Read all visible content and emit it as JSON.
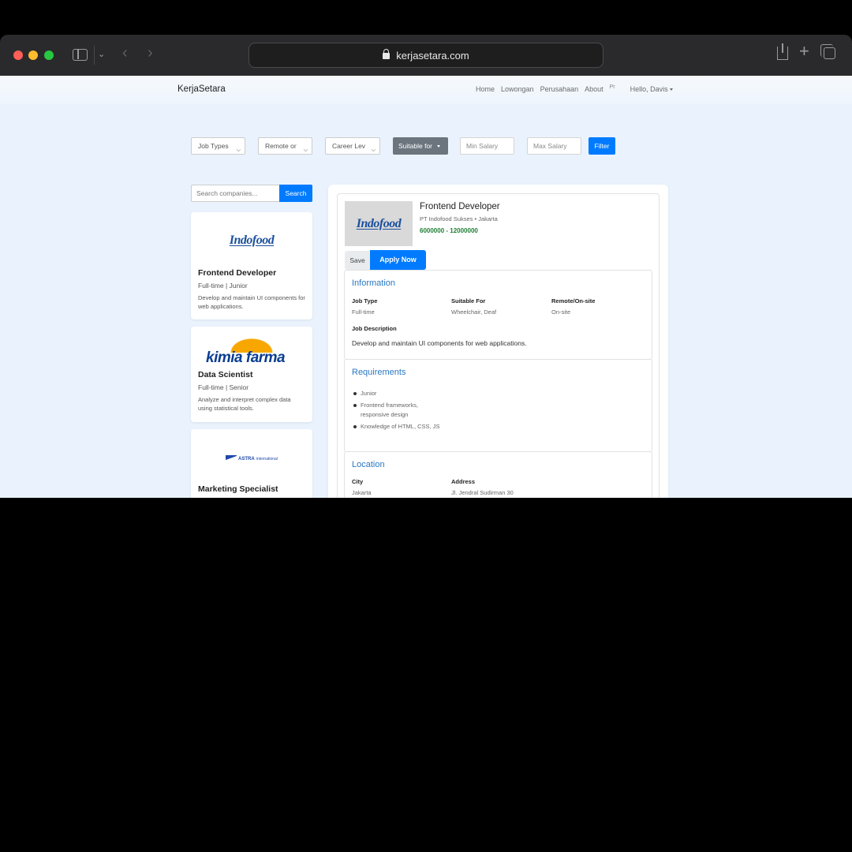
{
  "browser": {
    "url": "kerjasetara.com"
  },
  "navbar": {
    "brand": "KerjaSetara",
    "links": [
      "Home",
      "Lowongan",
      "Perusahaan",
      "About"
    ],
    "avatar_alt": "Pr",
    "user_greeting": "Hello, Davis"
  },
  "filters": {
    "job_types": "Job Types",
    "remote": "Remote or",
    "career_level": "Career Lev",
    "suitable_for": "Suitable for",
    "min_salary_placeholder": "Min Salary",
    "max_salary_placeholder": "Max Salary",
    "filter_label": "Filter"
  },
  "search": {
    "placeholder": "Search companies...",
    "button_label": "Search"
  },
  "jobs": [
    {
      "logo_text": "Indofood",
      "title": "Frontend Developer",
      "meta": "Full-time | Junior",
      "description": "Develop and maintain UI components for web applications."
    },
    {
      "logo_text": "kimia farma",
      "title": "Data Scientist",
      "meta": "Full-time | Senior",
      "description": "Analyze and interpret complex data using statistical tools."
    },
    {
      "logo_text_1": "ASTRA",
      "logo_text_2": "international",
      "title": "Marketing Specialist"
    }
  ],
  "detail": {
    "logo_text": "Indofood",
    "title": "Frontend Developer",
    "company": "PT Indofood Sukses • Jakarta",
    "salary": "6000000 - 12000000",
    "save_label": "Save",
    "apply_label": "Apply Now",
    "information": {
      "heading": "Information",
      "job_type_label": "Job Type",
      "job_type": "Full-time",
      "suitable_label": "Suitable For",
      "suitable": "Wheelchair, Deaf",
      "remote_label": "Remote/On-site",
      "remote": "On-site",
      "desc_label": "Job Description",
      "description": "Develop and maintain UI components for web applications."
    },
    "requirements": {
      "heading": "Requirements",
      "items": [
        "Junior",
        "Frontend frameworks, responsive design",
        "Knowledge of HTML, CSS, JS"
      ]
    },
    "location": {
      "heading": "Location",
      "city_label": "City",
      "city": "Jakarta",
      "address_label": "Address",
      "address": "Jl. Jendral Sudirman 30"
    }
  },
  "colors": {
    "primary": "#007bff",
    "secondary": "#6c757d",
    "salary_green": "#1e7e34",
    "section_heading": "#2a78c2",
    "page_bg": "#eaf3fd"
  }
}
